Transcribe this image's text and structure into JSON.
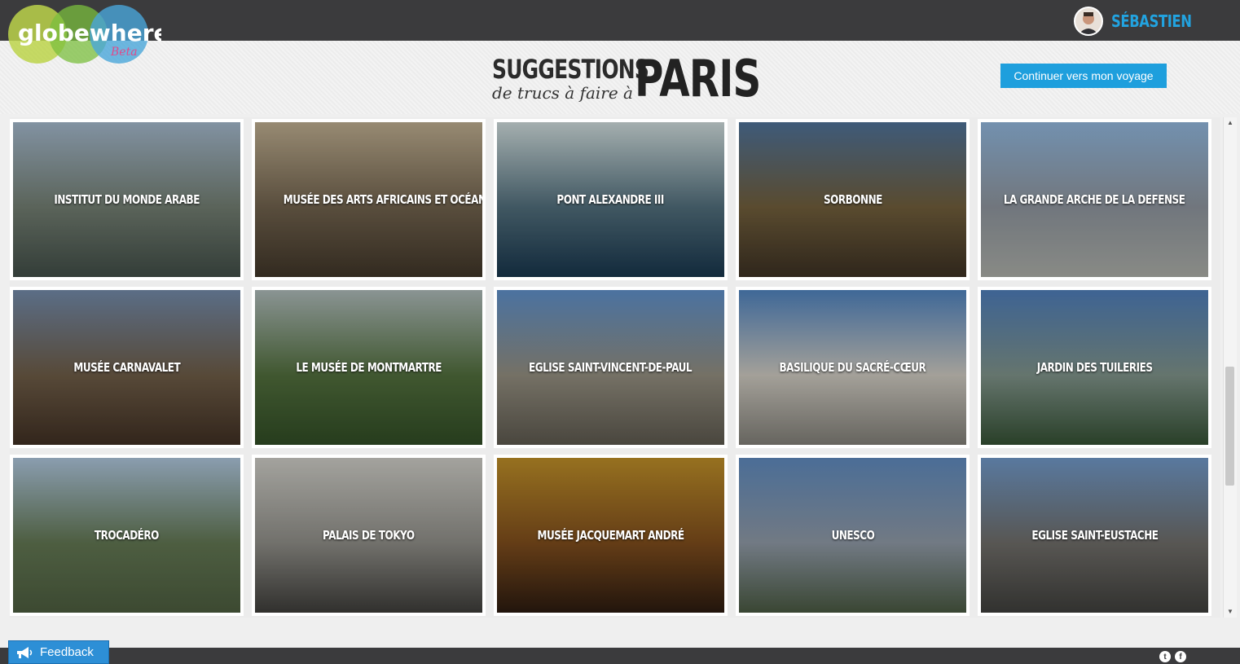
{
  "brand": {
    "logo_text": "globewhere",
    "logo_sub": "Beta"
  },
  "user": {
    "name": "SÉBASTIEN"
  },
  "header": {
    "title_main": "SUGGESTIONS",
    "title_sub": "de trucs à faire à",
    "city": "PARIS",
    "continue_label": "Continuer vers mon voyage"
  },
  "suggestions": [
    {
      "label": "INSTITUT DU MONDE ARABE",
      "colors": [
        "#9fb3c6",
        "#6f7a6e",
        "#3f4b45"
      ]
    },
    {
      "label": "MUSÉE DES ARTS AFRICAINS ET OCÉANIENS",
      "colors": [
        "#b9a98c",
        "#6d5f4b",
        "#3e3427"
      ]
    },
    {
      "label": "PONT ALEXANDRE III",
      "colors": [
        "#c9d6d6",
        "#4f6b78",
        "#17344a"
      ]
    },
    {
      "label": "SORBONNE",
      "colors": [
        "#4d6f94",
        "#6e5c3a",
        "#3a2f22"
      ]
    },
    {
      "label": "LA GRANDE ARCHE DE LA DEFENSE",
      "colors": [
        "#8db1d6",
        "#8a9199",
        "#a7a9a3"
      ]
    },
    {
      "label": "MUSÉE CARNAVALET",
      "colors": [
        "#6f86a4",
        "#6b5a45",
        "#3e2e22"
      ]
    },
    {
      "label": "LE MUSÉE DE MONTMARTRE",
      "colors": [
        "#a9b5b4",
        "#4f6b3b",
        "#2f4a24"
      ]
    },
    {
      "label": "EGLISE SAINT-VINCENT-DE-PAUL",
      "colors": [
        "#5c8bc4",
        "#8f8a7c",
        "#5a564c"
      ]
    },
    {
      "label": "BASILIQUE DU SACRÉ-CŒUR",
      "colors": [
        "#4d7fb9",
        "#c8c4bb",
        "#7d7b74"
      ]
    },
    {
      "label": "JARDIN DES TUILERIES",
      "colors": [
        "#4c7ab4",
        "#7c8f86",
        "#334e32"
      ]
    },
    {
      "label": "TROCADÉRO",
      "colors": [
        "#a9c0d6",
        "#5f7350",
        "#4a5a3d"
      ]
    },
    {
      "label": "PALAIS DE TOKYO",
      "colors": [
        "#c8c7c1",
        "#8b8a84",
        "#3c3b38"
      ]
    },
    {
      "label": "MUSÉE JACQUEMART ANDRÉ",
      "colors": [
        "#b88a27",
        "#7b4b1c",
        "#2a1a10"
      ]
    },
    {
      "label": "UNESCO",
      "colors": [
        "#5c86b8",
        "#8b95a1",
        "#47563f"
      ]
    },
    {
      "label": "EGLISE SAINT-EUSTACHE",
      "colors": [
        "#6d94c2",
        "#6c6a66",
        "#3d3d3a"
      ]
    }
  ],
  "footer": {
    "feedback_label": "Feedback"
  }
}
